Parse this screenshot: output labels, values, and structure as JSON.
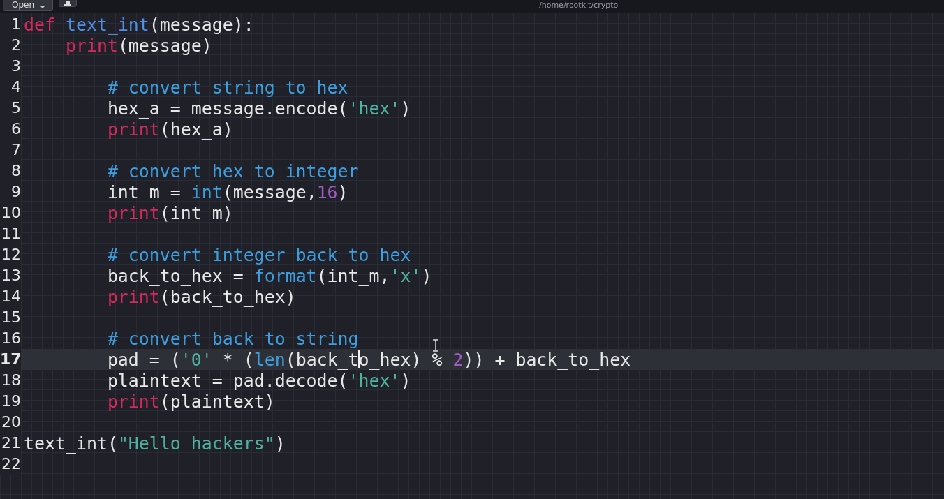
{
  "toolbar": {
    "open_button": "Open",
    "path": "/home/rootkit/crypto"
  },
  "lines": [
    {
      "number": "1",
      "current": false,
      "tokens": [
        {
          "kind": "keyword",
          "text": "def "
        },
        {
          "kind": "func",
          "text": "text_int"
        },
        {
          "kind": "plain",
          "text": "(message):"
        }
      ]
    },
    {
      "number": "2",
      "current": false,
      "tokens": [
        {
          "kind": "keyword",
          "text": "    print"
        },
        {
          "kind": "plain",
          "text": "(message)"
        }
      ]
    },
    {
      "number": "3",
      "current": false
    },
    {
      "number": "4",
      "current": false,
      "tokens": [
        {
          "kind": "comment",
          "text": "        # convert string to hex"
        }
      ]
    },
    {
      "number": "5",
      "current": false,
      "tokens": [
        {
          "kind": "plain",
          "text": "        hex_a = message.encode("
        },
        {
          "kind": "string",
          "text": "'hex'"
        },
        {
          "kind": "plain",
          "text": ")"
        }
      ]
    },
    {
      "number": "6",
      "current": false,
      "tokens": [
        {
          "kind": "keyword",
          "text": "        print"
        },
        {
          "kind": "plain",
          "text": "(hex_a)"
        }
      ]
    },
    {
      "number": "7",
      "current": false
    },
    {
      "number": "8",
      "current": false,
      "tokens": [
        {
          "kind": "comment",
          "text": "        # convert hex to integer"
        }
      ]
    },
    {
      "number": "9",
      "current": false,
      "tokens": [
        {
          "kind": "plain",
          "text": "        int_m = "
        },
        {
          "kind": "builtin",
          "text": "int"
        },
        {
          "kind": "plain",
          "text": "(message,"
        },
        {
          "kind": "number",
          "text": "16"
        },
        {
          "kind": "plain",
          "text": ")"
        }
      ]
    },
    {
      "number": "10",
      "current": false,
      "tokens": [
        {
          "kind": "keyword",
          "text": "        print"
        },
        {
          "kind": "plain",
          "text": "(int_m)"
        }
      ]
    },
    {
      "number": "11",
      "current": false
    },
    {
      "number": "12",
      "current": false,
      "tokens": [
        {
          "kind": "comment",
          "text": "        # convert integer back to hex"
        }
      ]
    },
    {
      "number": "13",
      "current": false,
      "tokens": [
        {
          "kind": "plain",
          "text": "        back_to_hex = "
        },
        {
          "kind": "builtin",
          "text": "format"
        },
        {
          "kind": "plain",
          "text": "(int_m,"
        },
        {
          "kind": "string",
          "text": "'x'"
        },
        {
          "kind": "plain",
          "text": ")"
        }
      ]
    },
    {
      "number": "14",
      "current": false,
      "tokens": [
        {
          "kind": "keyword",
          "text": "        print"
        },
        {
          "kind": "plain",
          "text": "(back_to_hex)"
        }
      ]
    },
    {
      "number": "15",
      "current": false
    },
    {
      "number": "16",
      "current": false,
      "tokens": [
        {
          "kind": "comment",
          "text": "        # convert back to string"
        }
      ]
    },
    {
      "number": "17",
      "current": true,
      "tokens": [
        {
          "kind": "plain",
          "text": "        pad = ("
        },
        {
          "kind": "string",
          "text": "'0'"
        },
        {
          "kind": "plain",
          "text": " * ("
        },
        {
          "kind": "builtin",
          "text": "len"
        },
        {
          "kind": "plain",
          "text": "(back_t"
        },
        {
          "kind": "cursor"
        },
        {
          "kind": "plain",
          "text": "o_hex) % "
        },
        {
          "kind": "number",
          "text": "2"
        },
        {
          "kind": "plain",
          "text": ")) + back_to_hex"
        }
      ]
    },
    {
      "number": "18",
      "current": false,
      "tokens": [
        {
          "kind": "plain",
          "text": "        plaintext = pad.decode("
        },
        {
          "kind": "string",
          "text": "'hex'"
        },
        {
          "kind": "plain",
          "text": ")"
        }
      ]
    },
    {
      "number": "19",
      "current": false,
      "tokens": [
        {
          "kind": "keyword",
          "text": "        print"
        },
        {
          "kind": "plain",
          "text": "(plaintext)"
        }
      ]
    },
    {
      "number": "20",
      "current": false
    },
    {
      "number": "21",
      "current": false,
      "tokens": [
        {
          "kind": "plain",
          "text": "text_int("
        },
        {
          "kind": "string",
          "text": "\"Hello hackers\""
        },
        {
          "kind": "plain",
          "text": ")"
        }
      ]
    },
    {
      "number": "22",
      "current": false
    }
  ]
}
